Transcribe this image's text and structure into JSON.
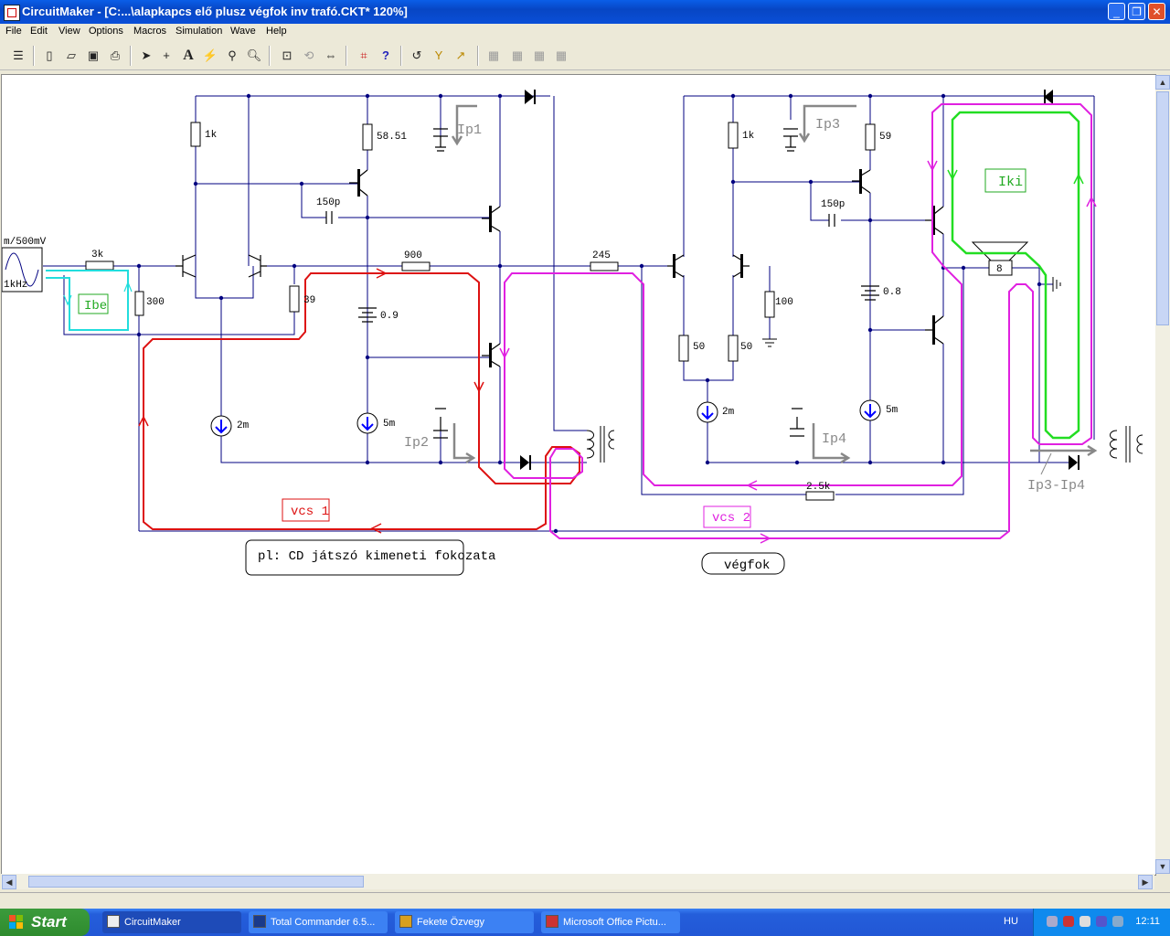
{
  "window": {
    "title": "CircuitMaker - [C:...\\alapkapcs elő plusz végfok inv trafó.CKT* 120%]",
    "minimize": "_",
    "restore": "❐",
    "close": "✕"
  },
  "menu": [
    "File",
    "Edit",
    "View",
    "Options",
    "Macros",
    "Simulation",
    "Wave",
    "Help"
  ],
  "circuit": {
    "source_top": "m/500mV",
    "source_bottom": "1kHz",
    "res_3k": "3k",
    "res_300": "300",
    "res_1k_left": "1k",
    "res_5851": "58.51",
    "cap_150p_left": "150p",
    "res_900": "900",
    "res_39": "39",
    "bat_09": "0.9",
    "cur_2m_left": "2m",
    "cur_5m_left": "5m",
    "res_245": "245",
    "res_1k_right": "1k",
    "res_59": "59",
    "cap_150p_right": "150p",
    "res_100": "100",
    "res_50a": "50",
    "res_50b": "50",
    "bat_08": "0.8",
    "cur_2m_right": "2m",
    "cur_5m_right": "5m",
    "res_25k": "2.5k",
    "speaker": "8",
    "ip1": "Ip1",
    "ip2": "Ip2",
    "ip3": "Ip3",
    "ip4": "Ip4",
    "ip34": "Ip3-Ip4",
    "ibe": "Ibe",
    "iki": "Iki",
    "vcs1": "vcs 1",
    "vcs2": "vcs 2",
    "note": "pl: CD játszó kimeneti fokozata",
    "vegfok": "végfok"
  },
  "taskbar": {
    "start": "Start",
    "items": [
      "CircuitMaker",
      "Total Commander 6.5...",
      "Fekete Özvegy",
      "Microsoft Office Pictu..."
    ],
    "lang": "HU",
    "time": "12:11"
  },
  "colors": {
    "wire": "#000080",
    "red_loop": "#dd1111",
    "magenta_loop": "#e020e0",
    "green_loop": "#22dd22",
    "cyan_loop": "#22dddd"
  }
}
